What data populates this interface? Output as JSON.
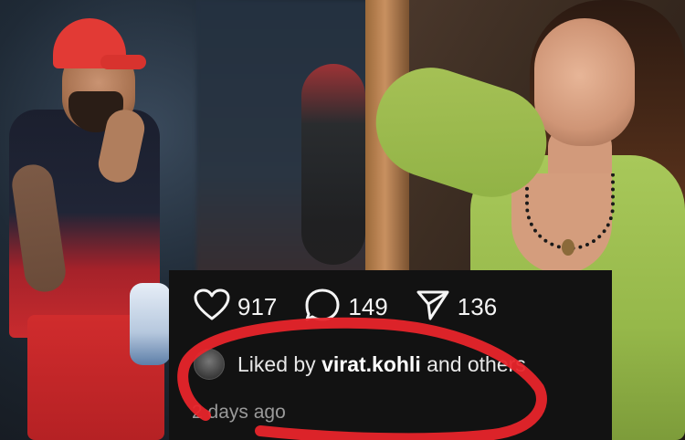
{
  "post": {
    "likes_count": "917",
    "comments_count": "149",
    "shares_count": "136",
    "liked_by_prefix": "Liked by ",
    "liked_by_user": "virat.kohli",
    "liked_by_suffix": " and others",
    "timestamp": "2 days ago"
  },
  "icons": {
    "like": "heart-icon",
    "comment": "comment-bubble-icon",
    "share": "paper-plane-icon"
  },
  "colors": {
    "card_bg": "#121212",
    "text_primary": "#f5f5f5",
    "text_muted": "#9a9a9a",
    "annotation": "#e8252b"
  }
}
